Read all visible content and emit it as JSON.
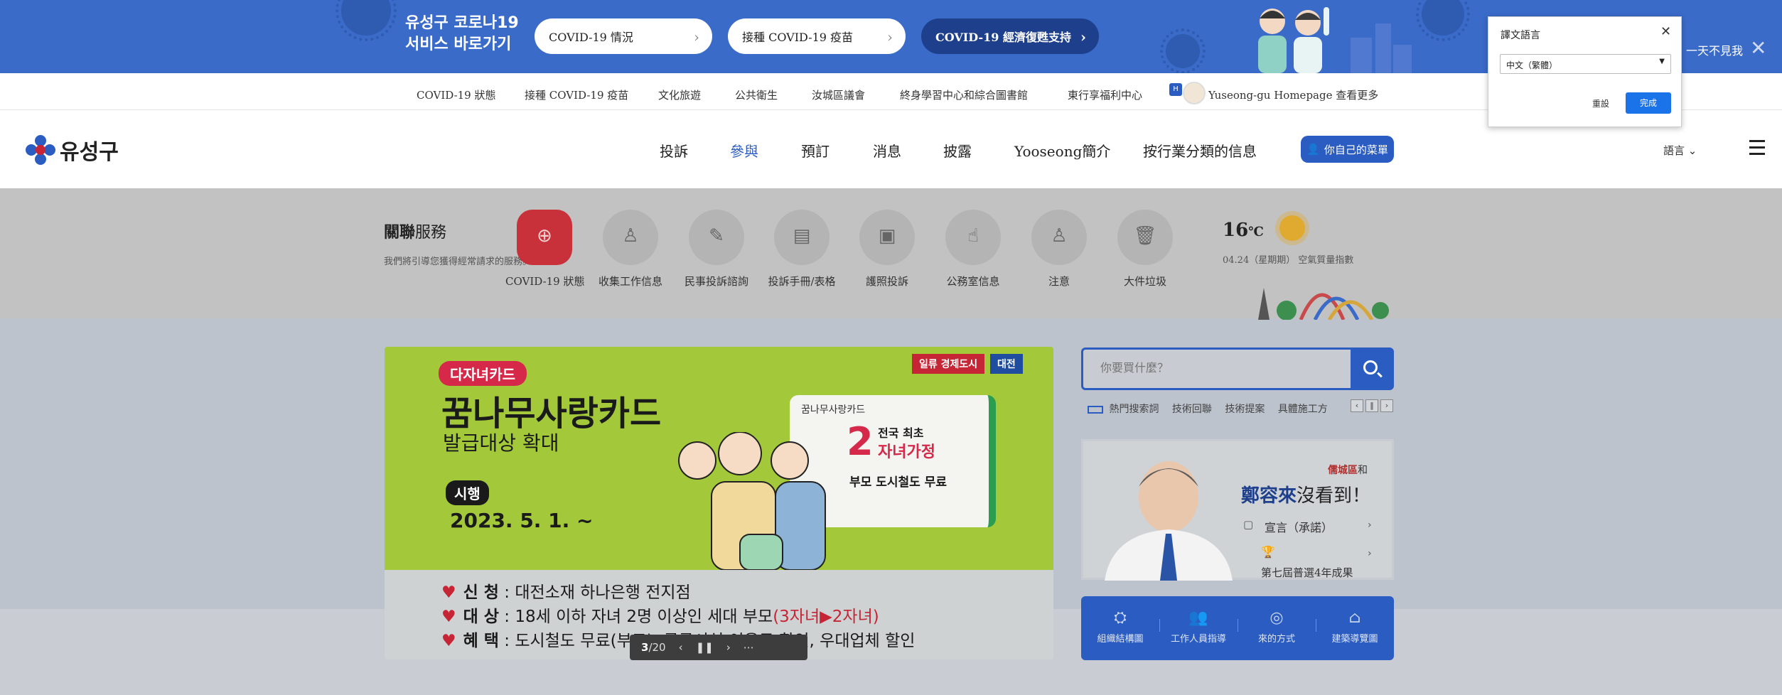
{
  "banner": {
    "title_line1": "유성구 코로나19",
    "title_line2": "서비스 바로가기",
    "pills": [
      {
        "label": "COVID-19 情況"
      },
      {
        "label": "接種 COVID-19 疫苗"
      },
      {
        "label": "COVID-19 經濟復甦支持"
      }
    ],
    "dismiss_text": "一天不見我",
    "close_icon": "close-icon"
  },
  "quicklinks": [
    "COVID-19 狀態",
    "接種 COVID-19 疫苗",
    "文化旅遊",
    "公共衛生",
    "汝城區議會",
    "終身學習中心和綜合圖書館",
    "東行享福利中心",
    "Yuseong-gu Homepage 查看更多"
  ],
  "header": {
    "logo_text": "유성구",
    "nav": [
      "投訴",
      "參與",
      "預訂",
      "消息",
      "披露",
      "Yooseong簡介",
      "按行業分類的信息"
    ],
    "active_nav": "參與",
    "my_menu": "你自己的菜單",
    "language": "語言"
  },
  "services": {
    "title_bold": "關聯",
    "title_rest": "服務",
    "desc": "我們將引導您獲得經常請求的服務。",
    "items": [
      {
        "label": "COVID-19 狀態",
        "icon": "covid-icon"
      },
      {
        "label": "收集工作信息",
        "icon": "person-icon"
      },
      {
        "label": "民事投訴諮詢",
        "icon": "edit-icon"
      },
      {
        "label": "投訴手冊/表格",
        "icon": "book-icon"
      },
      {
        "label": "護照投訴",
        "icon": "passport-icon"
      },
      {
        "label": "公務室信息",
        "icon": "handshake-icon"
      },
      {
        "label": "注意",
        "icon": "worker-icon"
      },
      {
        "label": "大件垃圾",
        "icon": "trash-icon"
      }
    ]
  },
  "weather": {
    "temp": "16",
    "unit": "℃",
    "date": "04.24（星期期）",
    "air": "空氣質量指數"
  },
  "promo": {
    "badge": "다자녀카드",
    "title": "꿈나무사랑카드",
    "subtitle": "발급대상 확대",
    "when_tag": "시행",
    "date": "2023. 5. 1. ~",
    "corner_left": "일류 경제도시",
    "corner_right": "대전",
    "card_label": "꿈나무사랑카드",
    "card_num": "2",
    "card_l1": "전국 최초",
    "card_l2": "자녀가정",
    "card_l3": "부모 도시철도 무료",
    "rows": [
      {
        "key": "신 청",
        "value": "대전소재 하나은행 전지점",
        "extra": ""
      },
      {
        "key": "대 상",
        "value": "18세 이하 자녀 2명 이상인 세대 부모",
        "extra": "(3자녀▶2자녀)"
      },
      {
        "key": "혜 택",
        "value": "도시철도 무료(부모), 공공시설 이용료 할인, 우대업체 할인",
        "extra": ""
      }
    ],
    "pager": {
      "current": "3",
      "total": "20"
    }
  },
  "search": {
    "placeholder": "你要買什麼？",
    "hot_label": "熱門搜索詞",
    "hot_terms": [
      "技術回聯",
      "技術提案",
      "具體施工方"
    ]
  },
  "mayor": {
    "l1_red": "儒城區",
    "l1_rest": "和",
    "l2_name": "鄭容來",
    "l2_rest": "沒看到！",
    "l3": "宣言（承諾）",
    "l4": "第七屆普選4年成果"
  },
  "org_links": [
    {
      "label": "組織結構圖",
      "icon": "org-chart-icon"
    },
    {
      "label": "工作人員指導",
      "icon": "staff-icon"
    },
    {
      "label": "來的方式",
      "icon": "location-icon"
    },
    {
      "label": "建築導覽圖",
      "icon": "building-icon"
    }
  ],
  "translate_popup": {
    "title": "譯文語言",
    "selected": "中文（繁體）",
    "cancel": "重設",
    "done": "完成"
  },
  "colors": {
    "brand": "#2a5cc2",
    "banner": "#3a6bc9",
    "accent_red": "#c62535"
  }
}
